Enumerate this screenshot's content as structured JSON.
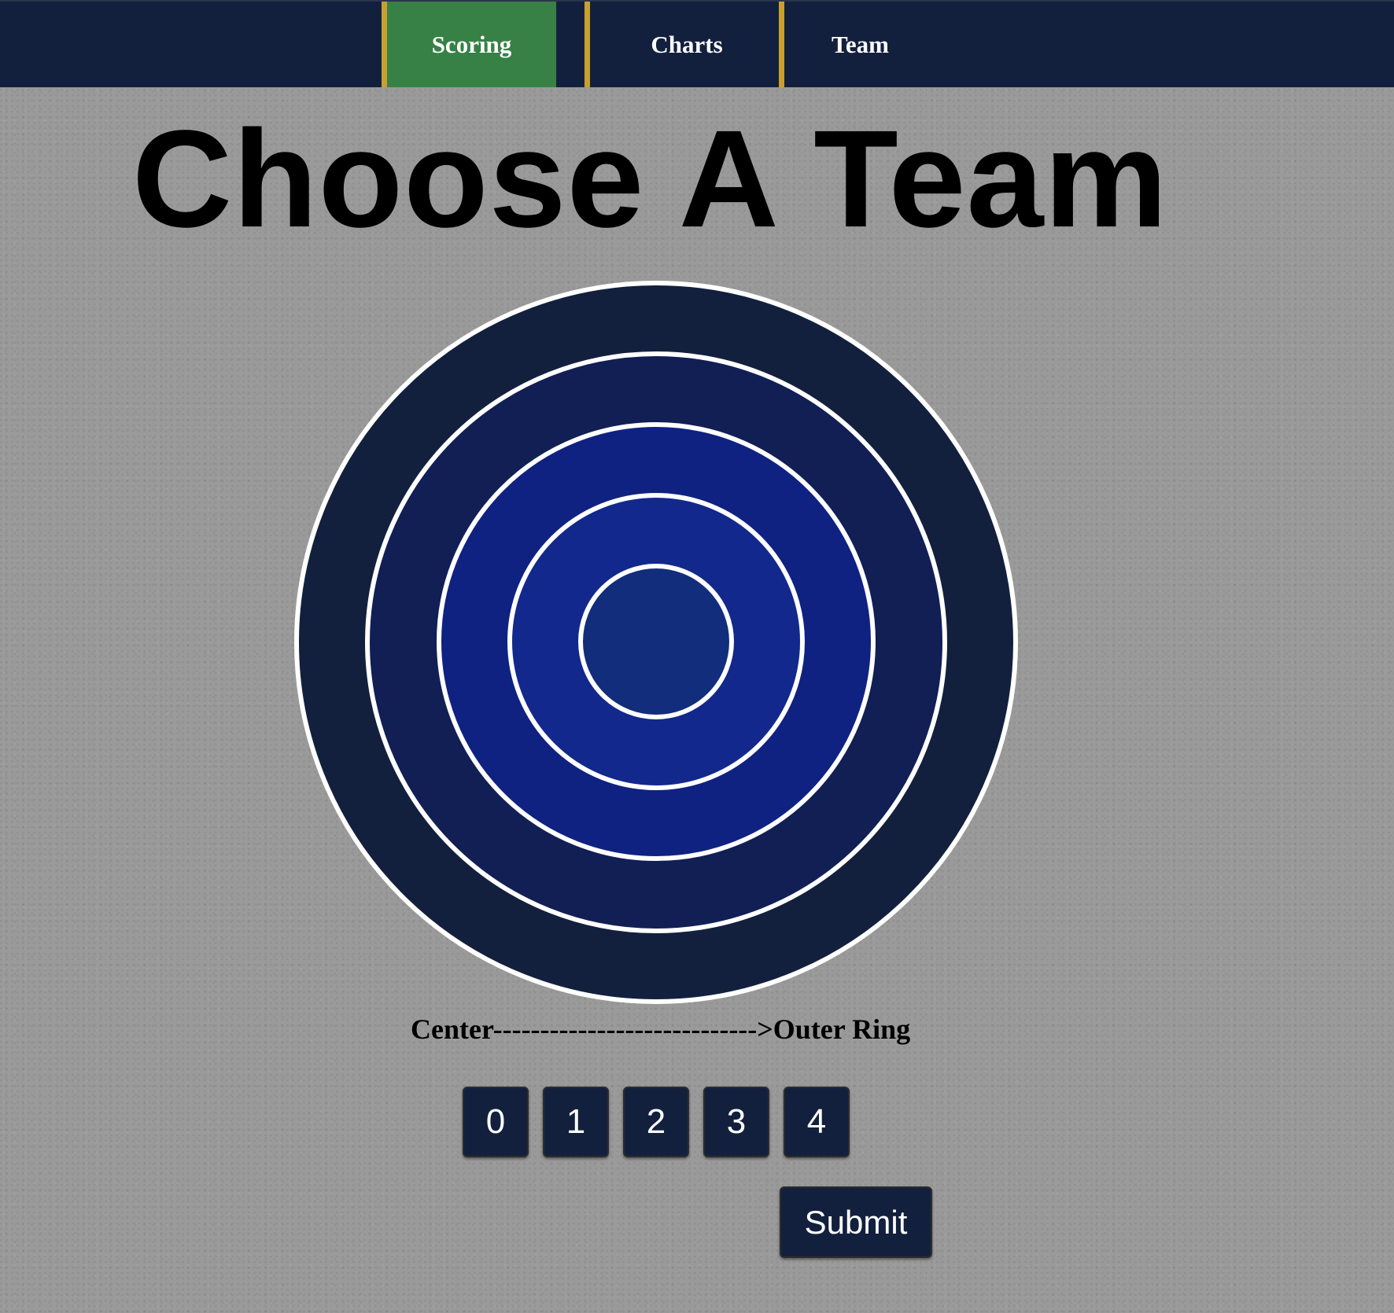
{
  "nav": {
    "tabs": [
      {
        "label": "Scoring",
        "active": true
      },
      {
        "label": "Charts",
        "active": false
      },
      {
        "label": "Team",
        "active": false
      }
    ]
  },
  "page": {
    "title": "Choose A Team"
  },
  "target": {
    "ring_colors": [
      "#13203d",
      "#111f55",
      "#0f2282",
      "#12288c",
      "#122d7c"
    ],
    "divider_color": "#ffffff"
  },
  "scale_label": "Center---------------------------->Outer Ring",
  "score_buttons": [
    "0",
    "1",
    "2",
    "3",
    "4"
  ],
  "submit_label": "Submit",
  "colors": {
    "nav_background": "#13203d",
    "active_tab": "#378146",
    "tab_divider": "#c9a030",
    "button_background": "#13203d"
  }
}
